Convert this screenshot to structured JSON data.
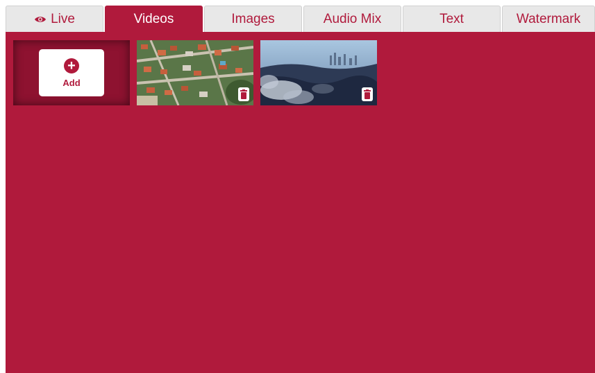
{
  "tabs": [
    {
      "label": "Live",
      "icon": "eye-icon",
      "active": false
    },
    {
      "label": "Videos",
      "active": true
    },
    {
      "label": "Images",
      "active": false
    },
    {
      "label": "Audio Mix",
      "active": false
    },
    {
      "label": "Text",
      "active": false
    },
    {
      "label": "Watermark",
      "active": false
    }
  ],
  "videos": {
    "add_label": "Add",
    "items": [
      {
        "thumbnail": "aerial-neighborhood-thumbnail",
        "delete_icon": "trash-icon"
      },
      {
        "thumbnail": "city-skyline-smoke-thumbnail",
        "delete_icon": "trash-icon"
      }
    ]
  },
  "colors": {
    "accent": "#b01a3c",
    "tab_inactive_bg": "#e8e8e8",
    "add_tile_bg": "#8e1230"
  }
}
